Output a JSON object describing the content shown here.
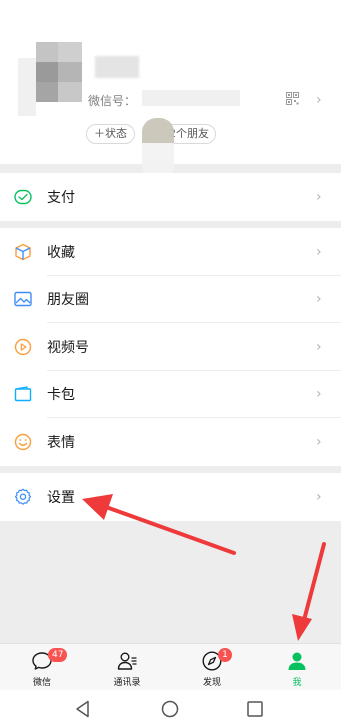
{
  "profile": {
    "wechat_id_label": "微信号：",
    "status_label": "＋状态",
    "friends_label": "2个朋友",
    "chevron": "›"
  },
  "groups": [
    {
      "items": [
        {
          "label": "支付",
          "icon": "pay-icon",
          "color": "#07c160"
        }
      ]
    },
    {
      "items": [
        {
          "label": "收藏",
          "icon": "favorites-cube-icon",
          "color": "#fa9d3b"
        },
        {
          "label": "朋友圈",
          "icon": "moments-image-icon",
          "color": "#3e8ef7"
        },
        {
          "label": "视频号",
          "icon": "channels-play-icon",
          "color": "#fa9d3b"
        },
        {
          "label": "卡包",
          "icon": "card-wallet-icon",
          "color": "#10aeff"
        },
        {
          "label": "表情",
          "icon": "sticker-smile-icon",
          "color": "#fa9d3b"
        }
      ]
    },
    {
      "items": [
        {
          "label": "设置",
          "icon": "settings-gear-icon",
          "color": "#3e8ef7"
        }
      ]
    }
  ],
  "chevron": "›",
  "tabbar": {
    "tabs": [
      {
        "label": "微信",
        "icon": "chat-bubble-icon",
        "badge": "47"
      },
      {
        "label": "通讯录",
        "icon": "contacts-icon",
        "badge": ""
      },
      {
        "label": "发现",
        "icon": "compass-icon",
        "badge": "1"
      },
      {
        "label": "我",
        "icon": "me-person-icon",
        "badge": ""
      }
    ],
    "active_index": 3,
    "active_color": "#07c160",
    "badge_color": "#fa5151"
  },
  "annotation_color": "#ee3a3a"
}
